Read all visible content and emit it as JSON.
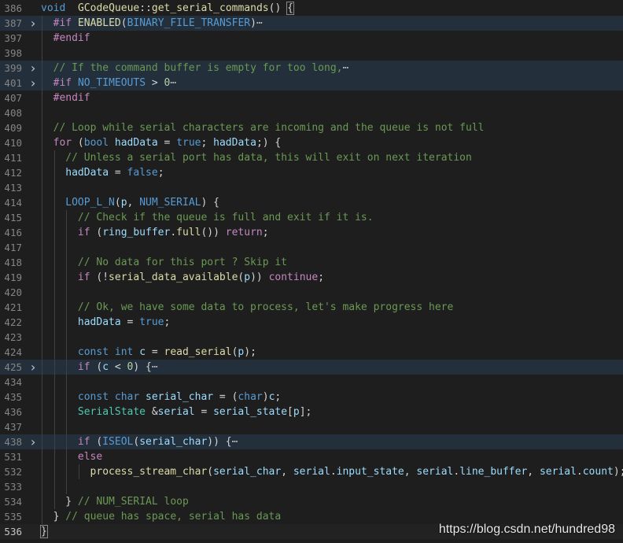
{
  "watermark": "https://blog.csdn.net/hundred98",
  "lines": [
    {
      "n": "386",
      "fold": false,
      "hl": false,
      "ind": 0,
      "toks": [
        [
          "kw",
          "void"
        ],
        [
          "",
          "  "
        ],
        [
          "fn",
          "GCodeQueue"
        ],
        [
          "",
          "::"
        ],
        [
          "fn",
          "get_serial_commands"
        ],
        [
          "",
          "() "
        ],
        [
          "brk",
          "{"
        ]
      ]
    },
    {
      "n": "387",
      "fold": true,
      "hl": true,
      "ind": 1,
      "toks": [
        [
          "pp",
          "#if"
        ],
        [
          "",
          " "
        ],
        [
          "fn",
          "ENABLED"
        ],
        [
          "",
          "("
        ],
        [
          "mac",
          "BINARY_FILE_TRANSFER"
        ],
        [
          "",
          ")"
        ],
        [
          "el",
          "⋯"
        ]
      ]
    },
    {
      "n": "397",
      "fold": false,
      "hl": false,
      "ind": 1,
      "toks": [
        [
          "pp",
          "#endif"
        ]
      ]
    },
    {
      "n": "398",
      "fold": false,
      "hl": false,
      "ind": 0,
      "toks": []
    },
    {
      "n": "399",
      "fold": true,
      "hl": true,
      "ind": 1,
      "toks": [
        [
          "cm",
          "// If the command buffer is empty for too long,"
        ],
        [
          "el",
          "⋯"
        ]
      ]
    },
    {
      "n": "401",
      "fold": true,
      "hl": true,
      "ind": 1,
      "toks": [
        [
          "pp",
          "#if"
        ],
        [
          "",
          " "
        ],
        [
          "mac",
          "NO_TIMEOUTS"
        ],
        [
          "",
          " > "
        ],
        [
          "nu",
          "0"
        ],
        [
          "el",
          "⋯"
        ]
      ]
    },
    {
      "n": "407",
      "fold": false,
      "hl": false,
      "ind": 1,
      "toks": [
        [
          "pp",
          "#endif"
        ]
      ]
    },
    {
      "n": "408",
      "fold": false,
      "hl": false,
      "ind": 0,
      "toks": []
    },
    {
      "n": "409",
      "fold": false,
      "hl": false,
      "ind": 1,
      "toks": [
        [
          "cm",
          "// Loop while serial characters are incoming and the queue is not full"
        ]
      ]
    },
    {
      "n": "410",
      "fold": false,
      "hl": false,
      "ind": 1,
      "toks": [
        [
          "ctl",
          "for"
        ],
        [
          "",
          " ("
        ],
        [
          "kw",
          "bool"
        ],
        [
          "",
          " "
        ],
        [
          "va",
          "hadData"
        ],
        [
          "",
          " = "
        ],
        [
          "kw",
          "true"
        ],
        [
          "",
          "; "
        ],
        [
          "va",
          "hadData"
        ],
        [
          "",
          ";) {"
        ]
      ]
    },
    {
      "n": "411",
      "fold": false,
      "hl": false,
      "ind": 2,
      "toks": [
        [
          "cm",
          "// Unless a serial port has data, this will exit on next iteration"
        ]
      ]
    },
    {
      "n": "412",
      "fold": false,
      "hl": false,
      "ind": 2,
      "toks": [
        [
          "va",
          "hadData"
        ],
        [
          "",
          " = "
        ],
        [
          "kw",
          "false"
        ],
        [
          "",
          ";"
        ]
      ]
    },
    {
      "n": "413",
      "fold": false,
      "hl": false,
      "ind": 0,
      "toks": []
    },
    {
      "n": "414",
      "fold": false,
      "hl": false,
      "ind": 2,
      "toks": [
        [
          "mac",
          "LOOP_L_N"
        ],
        [
          "",
          "("
        ],
        [
          "va",
          "p"
        ],
        [
          "",
          ", "
        ],
        [
          "mac",
          "NUM_SERIAL"
        ],
        [
          "",
          ") {"
        ]
      ]
    },
    {
      "n": "415",
      "fold": false,
      "hl": false,
      "ind": 3,
      "toks": [
        [
          "cm",
          "// Check if the queue is full and exit if it is."
        ]
      ]
    },
    {
      "n": "416",
      "fold": false,
      "hl": false,
      "ind": 3,
      "toks": [
        [
          "ctl",
          "if"
        ],
        [
          "",
          " ("
        ],
        [
          "va",
          "ring_buffer"
        ],
        [
          "",
          "."
        ],
        [
          "fn",
          "full"
        ],
        [
          "",
          "()) "
        ],
        [
          "ctl",
          "return"
        ],
        [
          "",
          ";"
        ]
      ]
    },
    {
      "n": "417",
      "fold": false,
      "hl": false,
      "ind": 0,
      "toks": []
    },
    {
      "n": "418",
      "fold": false,
      "hl": false,
      "ind": 3,
      "toks": [
        [
          "cm",
          "// No data for this port ? Skip it"
        ]
      ]
    },
    {
      "n": "419",
      "fold": false,
      "hl": false,
      "ind": 3,
      "toks": [
        [
          "ctl",
          "if"
        ],
        [
          "",
          " (!"
        ],
        [
          "fn",
          "serial_data_available"
        ],
        [
          "",
          "("
        ],
        [
          "va",
          "p"
        ],
        [
          "",
          "))"
        ],
        [
          "",
          " "
        ],
        [
          "ctl",
          "continue"
        ],
        [
          "",
          ";"
        ]
      ]
    },
    {
      "n": "420",
      "fold": false,
      "hl": false,
      "ind": 0,
      "toks": []
    },
    {
      "n": "421",
      "fold": false,
      "hl": false,
      "ind": 3,
      "toks": [
        [
          "cm",
          "// Ok, we have some data to process, let's make progress here"
        ]
      ]
    },
    {
      "n": "422",
      "fold": false,
      "hl": false,
      "ind": 3,
      "toks": [
        [
          "va",
          "hadData"
        ],
        [
          "",
          " = "
        ],
        [
          "kw",
          "true"
        ],
        [
          "",
          ";"
        ]
      ]
    },
    {
      "n": "423",
      "fold": false,
      "hl": false,
      "ind": 0,
      "toks": []
    },
    {
      "n": "424",
      "fold": false,
      "hl": false,
      "ind": 3,
      "toks": [
        [
          "kw",
          "const"
        ],
        [
          "",
          " "
        ],
        [
          "kw",
          "int"
        ],
        [
          "",
          " "
        ],
        [
          "va",
          "c"
        ],
        [
          "",
          " = "
        ],
        [
          "fn",
          "read_serial"
        ],
        [
          "",
          "("
        ],
        [
          "va",
          "p"
        ],
        [
          "",
          ");"
        ]
      ]
    },
    {
      "n": "425",
      "fold": true,
      "hl": true,
      "ind": 3,
      "toks": [
        [
          "ctl",
          "if"
        ],
        [
          "",
          " ("
        ],
        [
          "va",
          "c"
        ],
        [
          "",
          " < "
        ],
        [
          "nu",
          "0"
        ],
        [
          "",
          ") {"
        ],
        [
          "el",
          "⋯"
        ]
      ]
    },
    {
      "n": "434",
      "fold": false,
      "hl": false,
      "ind": 0,
      "toks": []
    },
    {
      "n": "435",
      "fold": false,
      "hl": false,
      "ind": 3,
      "toks": [
        [
          "kw",
          "const"
        ],
        [
          "",
          " "
        ],
        [
          "kw",
          "char"
        ],
        [
          "",
          " "
        ],
        [
          "va",
          "serial_char"
        ],
        [
          "",
          " = ("
        ],
        [
          "kw",
          "char"
        ],
        [
          "",
          ")"
        ],
        [
          "va",
          "c"
        ],
        [
          "",
          ";"
        ]
      ]
    },
    {
      "n": "436",
      "fold": false,
      "hl": false,
      "ind": 3,
      "toks": [
        [
          "ty",
          "SerialState"
        ],
        [
          "",
          " &"
        ],
        [
          "va",
          "serial"
        ],
        [
          "",
          " = "
        ],
        [
          "va",
          "serial_state"
        ],
        [
          "",
          "["
        ],
        [
          "va",
          "p"
        ],
        [
          "",
          "];"
        ]
      ]
    },
    {
      "n": "437",
      "fold": false,
      "hl": false,
      "ind": 0,
      "toks": []
    },
    {
      "n": "438",
      "fold": true,
      "hl": true,
      "ind": 3,
      "toks": [
        [
          "ctl",
          "if"
        ],
        [
          "",
          " ("
        ],
        [
          "mac",
          "ISEOL"
        ],
        [
          "",
          "("
        ],
        [
          "va",
          "serial_char"
        ],
        [
          "",
          "))"
        ],
        [
          "",
          " {"
        ],
        [
          "el",
          "⋯"
        ]
      ]
    },
    {
      "n": "531",
      "fold": false,
      "hl": false,
      "ind": 3,
      "toks": [
        [
          "ctl",
          "else"
        ]
      ]
    },
    {
      "n": "532",
      "fold": false,
      "hl": false,
      "ind": 4,
      "toks": [
        [
          "fn",
          "process_stream_char"
        ],
        [
          "",
          "("
        ],
        [
          "va",
          "serial_char"
        ],
        [
          "",
          ", "
        ],
        [
          "va",
          "serial"
        ],
        [
          "",
          "."
        ],
        [
          "va",
          "input_state"
        ],
        [
          "",
          ", "
        ],
        [
          "va",
          "serial"
        ],
        [
          "",
          "."
        ],
        [
          "va",
          "line_buffer"
        ],
        [
          "",
          ", "
        ],
        [
          "va",
          "serial"
        ],
        [
          "",
          "."
        ],
        [
          "va",
          "count"
        ],
        [
          "",
          ");"
        ]
      ]
    },
    {
      "n": "533",
      "fold": false,
      "hl": false,
      "ind": 0,
      "toks": []
    },
    {
      "n": "534",
      "fold": false,
      "hl": false,
      "ind": 2,
      "toks": [
        [
          "",
          "} "
        ],
        [
          "cm",
          "// NUM_SERIAL loop"
        ]
      ]
    },
    {
      "n": "535",
      "fold": false,
      "hl": false,
      "ind": 1,
      "toks": [
        [
          "",
          "} "
        ],
        [
          "cm",
          "// queue has space, serial has data"
        ]
      ]
    },
    {
      "n": "536",
      "fold": false,
      "hl": false,
      "ind": 0,
      "cursor": true,
      "toks": [
        [
          "brk",
          "}"
        ]
      ]
    }
  ]
}
